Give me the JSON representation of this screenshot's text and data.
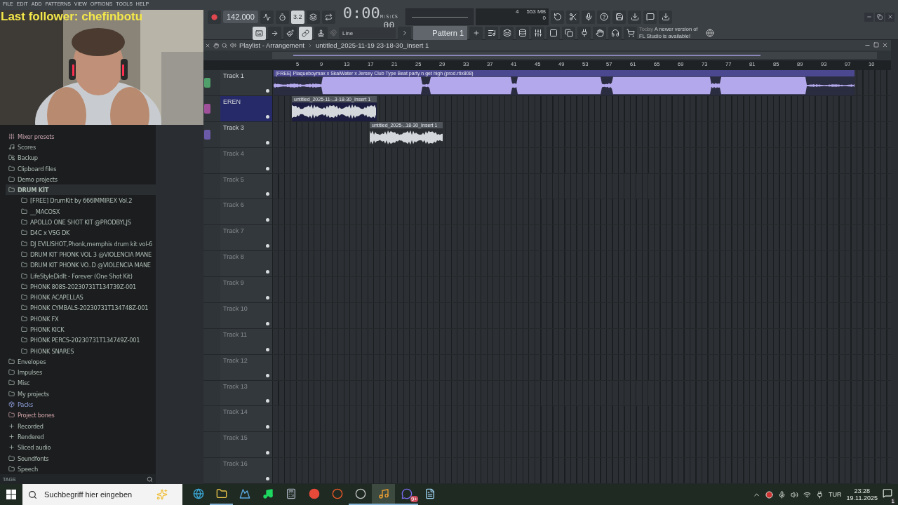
{
  "menu": [
    "FILE",
    "EDIT",
    "ADD",
    "PATTERNS",
    "VIEW",
    "OPTIONS",
    "TOOLS",
    "HELP"
  ],
  "stream_overlay": {
    "text": "Last follower: chefinbotu"
  },
  "toolbar": {
    "tempo": "142.000",
    "time": "0:00",
    "time_cs": "00",
    "time_format": "M:S:CS",
    "cpu": "4",
    "memory": "553 MB",
    "polyphony": "0",
    "snap": "Line",
    "pattern": "Pattern 1",
    "news_date": "Today",
    "news": "A newer version of FL Studio is available!",
    "record_buttons": [
      {
        "kind": "metronome",
        "on": false
      },
      {
        "kind": "wait",
        "on": false
      },
      {
        "kind": "countdown",
        "label": "3.2",
        "on": true
      },
      {
        "kind": "overdub",
        "on": false
      },
      {
        "kind": "loop",
        "on": false
      }
    ],
    "mode_buttons": [
      {
        "kind": "keyboard",
        "on": true
      },
      {
        "kind": "arrow",
        "on": false
      },
      {
        "kind": "brush",
        "on": false
      },
      {
        "kind": "link",
        "on": true
      },
      {
        "kind": "stamp",
        "on": false
      }
    ]
  },
  "browser": {
    "items": [
      {
        "label": "Mixer presets",
        "kind": "mixer",
        "expanded": false
      },
      {
        "label": "Scores",
        "kind": "score",
        "expanded": false
      },
      {
        "label": "Backup",
        "kind": "backup",
        "expanded": false
      },
      {
        "label": "Clipboard files",
        "kind": "folder",
        "expanded": false
      },
      {
        "label": "Demo projects",
        "kind": "folder",
        "expanded": false
      },
      {
        "label": "DRUM KİT",
        "kind": "folder",
        "expanded": true,
        "children": [
          {
            "label": "[FREE] DrumKit by 666IMMIREX Vol.2"
          },
          {
            "label": "__MACOSX"
          },
          {
            "label": "APOLLO ONE SHOT KIT @PRODBYLJS"
          },
          {
            "label": "D4C x VSG DK"
          },
          {
            "label": "DJ EVILISHOT,Phonk,memphis drum kit vol-6"
          },
          {
            "label": "DRUM KIT PHONK VOL 3 @VIOLENCIA MANE"
          },
          {
            "label": "DRUM KIT PHONK VO..D @VIOLENCIA MANE"
          },
          {
            "label": "LifeStyleDidIt - Forever (One Shot Kit)"
          },
          {
            "label": "PHONK 808S-20230731T134739Z-001"
          },
          {
            "label": "PHONK ACAPELLAS"
          },
          {
            "label": "PHONK CYMBALS-20230731T134748Z-001"
          },
          {
            "label": "PHONK FX"
          },
          {
            "label": "PHONK KICK"
          },
          {
            "label": "PHONK PERCS-20230731T134749Z-001"
          },
          {
            "label": "PHONK SNARES"
          }
        ]
      },
      {
        "label": "Envelopes",
        "kind": "folder",
        "expanded": false
      },
      {
        "label": "Impulses",
        "kind": "folder",
        "expanded": false
      },
      {
        "label": "Misc",
        "kind": "plain",
        "expanded": false
      },
      {
        "label": "My projects",
        "kind": "folder",
        "expanded": false
      },
      {
        "label": "Packs",
        "kind": "packs",
        "expanded": false
      },
      {
        "label": "Project bones",
        "kind": "bones",
        "expanded": false
      },
      {
        "label": "Recorded",
        "kind": "audio",
        "expanded": false
      },
      {
        "label": "Rendered",
        "kind": "audio",
        "expanded": false
      },
      {
        "label": "Sliced audio",
        "kind": "audio",
        "expanded": false
      },
      {
        "label": "Soundfonts",
        "kind": "plain",
        "expanded": false
      },
      {
        "label": "Speech",
        "kind": "folder",
        "expanded": false
      }
    ],
    "footer": "TAGS"
  },
  "playlist": {
    "title": "Playlist - Arrangement",
    "breadcrumb": "untitled_2025-11-19 23-18-30_Insert 1",
    "ruler": [
      "5",
      "9",
      "13",
      "17",
      "21",
      "25",
      "29",
      "33",
      "37",
      "41",
      "45",
      "49",
      "53",
      "57",
      "61",
      "65",
      "69",
      "73",
      "77",
      "81",
      "85",
      "89",
      "93",
      "97",
      "10"
    ],
    "tracks": [
      {
        "name": "Track 1",
        "selected": false,
        "color": "#4fa06a",
        "clips": [
          {
            "title": "[FREE] Plaqueboymax x SkaiWater x Jersey Club Type Beat party n get high (prod.rtix808)"
          }
        ]
      },
      {
        "name": "EREN",
        "selected": true,
        "color": "#a0509a",
        "clips": [
          {
            "title": "untitled_2025-11-..3-18-30_Insert 1"
          }
        ]
      },
      {
        "name": "Track 3",
        "selected": false,
        "color": "#6a5aa8",
        "clips": [
          {
            "title": "untitled_2025-..18-30_Insert 1"
          }
        ]
      },
      {
        "name": "Track 4",
        "selected": false
      },
      {
        "name": "Track 5",
        "selected": false
      },
      {
        "name": "Track 6",
        "selected": false
      },
      {
        "name": "Track 7",
        "selected": false
      },
      {
        "name": "Track 8",
        "selected": false
      },
      {
        "name": "Track 9",
        "selected": false
      },
      {
        "name": "Track 10",
        "selected": false
      },
      {
        "name": "Track 11",
        "selected": false
      },
      {
        "name": "Track 12",
        "selected": false
      },
      {
        "name": "Track 13",
        "selected": false
      },
      {
        "name": "Track 14",
        "selected": false
      },
      {
        "name": "Track 15",
        "selected": false
      },
      {
        "name": "Track 16",
        "selected": false
      }
    ]
  },
  "taskbar": {
    "search_placeholder": "Suchbegriff hier eingeben",
    "apps": [
      {
        "kind": "edge",
        "open": false,
        "active": false
      },
      {
        "kind": "explorer",
        "open": true,
        "active": false
      },
      {
        "kind": "photos",
        "open": false,
        "active": false
      },
      {
        "kind": "spotify",
        "open": false,
        "active": false
      },
      {
        "kind": "calculator",
        "open": false,
        "active": false
      },
      {
        "kind": "chrome",
        "open": false,
        "active": false
      },
      {
        "kind": "brave",
        "open": false,
        "active": false
      },
      {
        "kind": "obs",
        "open": true,
        "active": false
      },
      {
        "kind": "fl",
        "open": true,
        "active": true
      },
      {
        "kind": "discord",
        "open": true,
        "active": false,
        "badge": "9+"
      },
      {
        "kind": "notepad",
        "open": false,
        "active": false
      }
    ],
    "language": "TUR",
    "time": "23:28",
    "date": "19.11.2025",
    "notifications": "1"
  }
}
